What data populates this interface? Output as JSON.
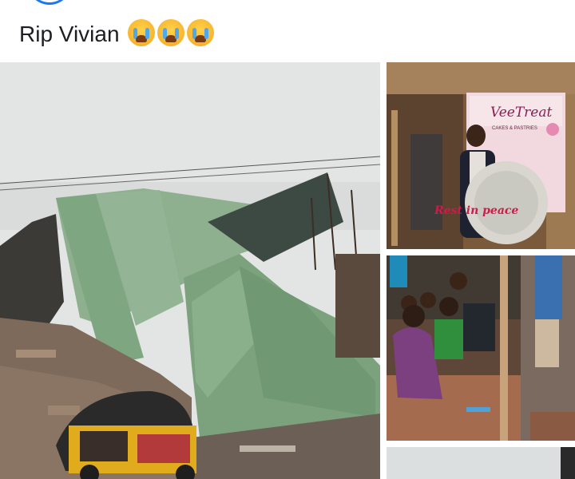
{
  "post": {
    "caption": "Rip Vivian",
    "emoji": [
      "loudly-crying-face",
      "loudly-crying-face",
      "loudly-crying-face"
    ]
  },
  "photos": {
    "banner_brand": "VeeTreat",
    "banner_tagline": "CAKES & PASTRIES",
    "wreath_text": "Rest in peace"
  },
  "colors": {
    "roof_green": "#7aa37c",
    "sky": "#e6e8e7",
    "tricycle_yellow": "#e8b21a",
    "facebook_blue": "#1877f2"
  }
}
